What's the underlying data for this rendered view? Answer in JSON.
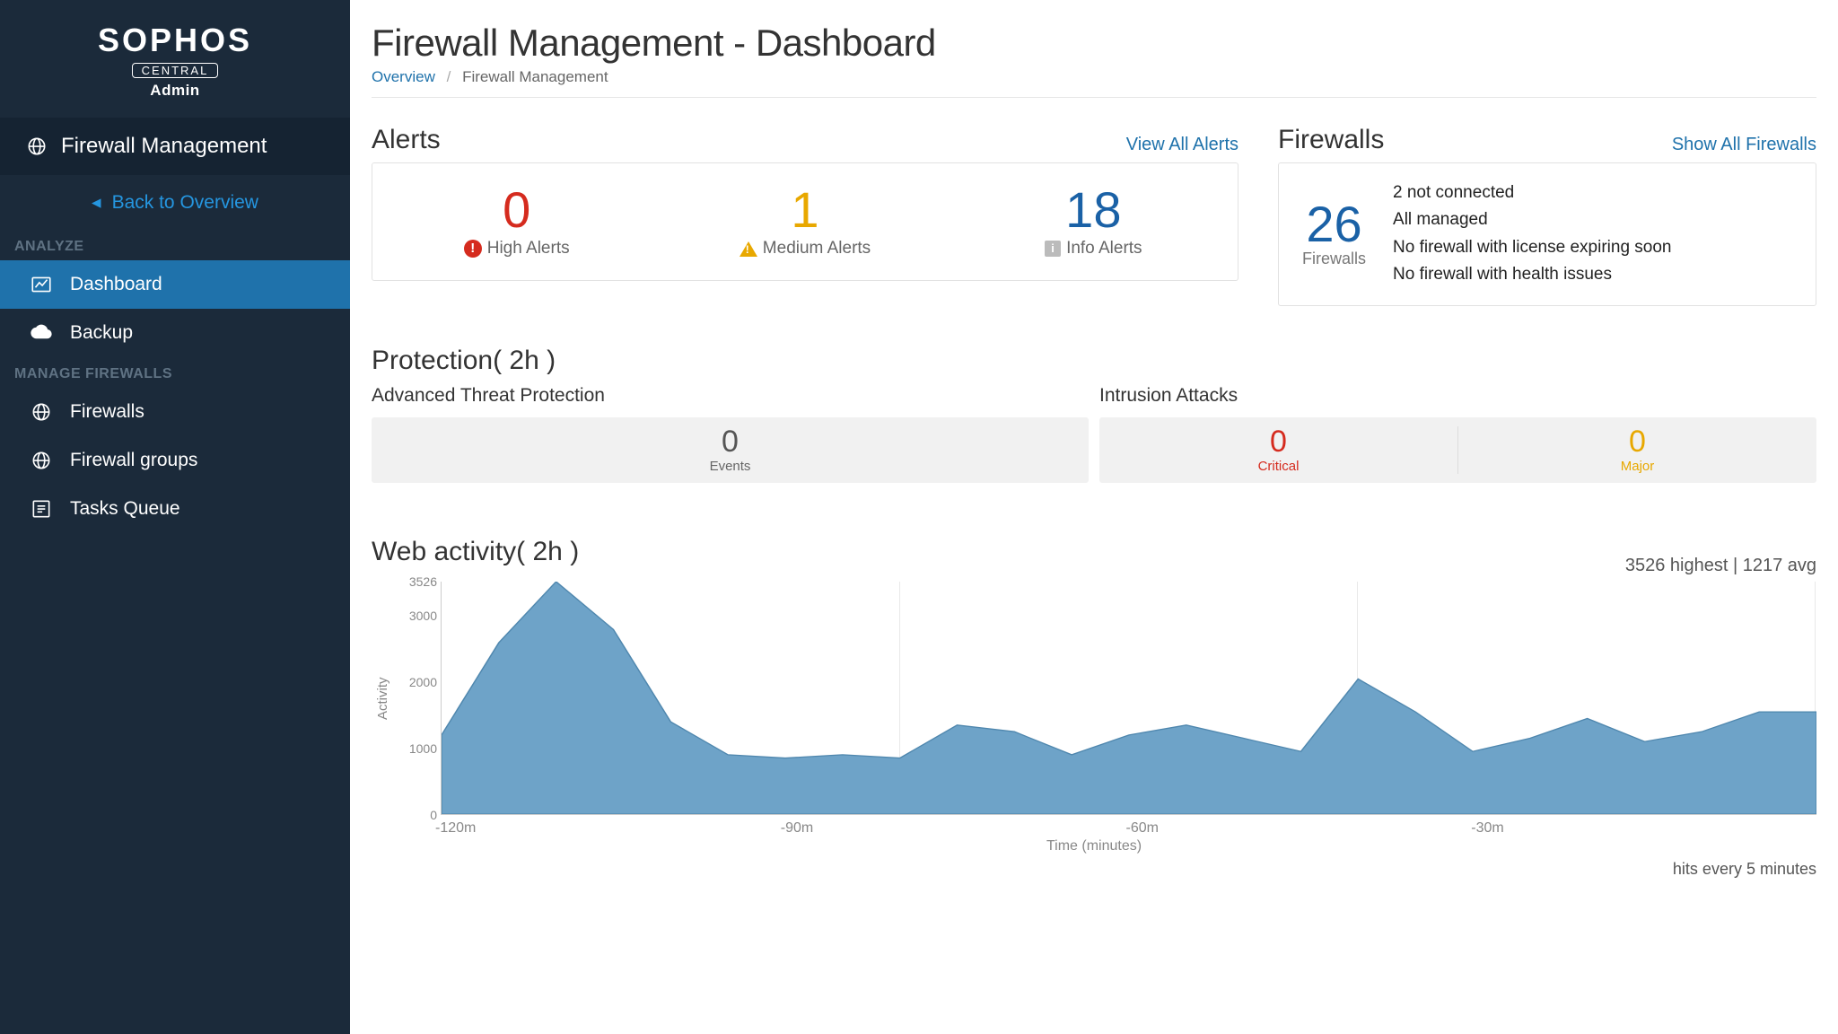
{
  "brand": {
    "main": "SOPHOS",
    "sub": "CENTRAL",
    "admin": "Admin"
  },
  "sidebar": {
    "section_title": "Firewall Management",
    "back": "Back to Overview",
    "heading_analyze": "ANALYZE",
    "heading_manage": "MANAGE FIREWALLS",
    "items": {
      "dashboard": "Dashboard",
      "backup": "Backup",
      "firewalls": "Firewalls",
      "firewall_groups": "Firewall groups",
      "tasks_queue": "Tasks Queue"
    }
  },
  "page": {
    "title": "Firewall Management - Dashboard",
    "crumb_overview": "Overview",
    "crumb_current": "Firewall Management"
  },
  "alerts": {
    "heading": "Alerts",
    "view_all": "View All Alerts",
    "high": {
      "value": "0",
      "label": "High Alerts"
    },
    "medium": {
      "value": "1",
      "label": "Medium Alerts"
    },
    "info": {
      "value": "18",
      "label": "Info Alerts"
    }
  },
  "firewalls": {
    "heading": "Firewalls",
    "show_all": "Show All Firewalls",
    "count": "26",
    "count_label": "Firewalls",
    "lines": [
      "2 not connected",
      "All managed",
      "No firewall with license expiring soon",
      "No firewall with health issues"
    ]
  },
  "protection": {
    "heading": "Protection( 2h )",
    "atp": {
      "title": "Advanced Threat Protection",
      "events_value": "0",
      "events_label": "Events"
    },
    "intrusion": {
      "title": "Intrusion Attacks",
      "critical_value": "0",
      "critical_label": "Critical",
      "major_value": "0",
      "major_label": "Major"
    }
  },
  "web_activity": {
    "heading": "Web activity( 2h )",
    "stats": "3526 highest | 1217 avg",
    "y_label": "Activity",
    "x_label": "Time (minutes)",
    "hits": "hits every 5 minutes"
  },
  "chart_data": {
    "type": "area",
    "ylabel": "Activity",
    "xlabel": "Time (minutes)",
    "ylim": [
      0,
      3526
    ],
    "y_ticks": [
      0,
      1000,
      2000,
      3000,
      3526
    ],
    "x_ticks": [
      "-120m",
      "-90m",
      "-60m",
      "-30m"
    ],
    "x": [
      -120,
      -115,
      -110,
      -105,
      -100,
      -95,
      -90,
      -85,
      -80,
      -75,
      -70,
      -65,
      -60,
      -55,
      -50,
      -45,
      -40,
      -35,
      -30,
      -25,
      -20,
      -15,
      -10,
      -5,
      0
    ],
    "values": [
      1200,
      2600,
      3526,
      2800,
      1400,
      900,
      850,
      900,
      850,
      1350,
      1250,
      900,
      1200,
      1350,
      1150,
      950,
      2050,
      1550,
      950,
      1150,
      1450,
      1100,
      1250,
      1550,
      1550
    ]
  }
}
